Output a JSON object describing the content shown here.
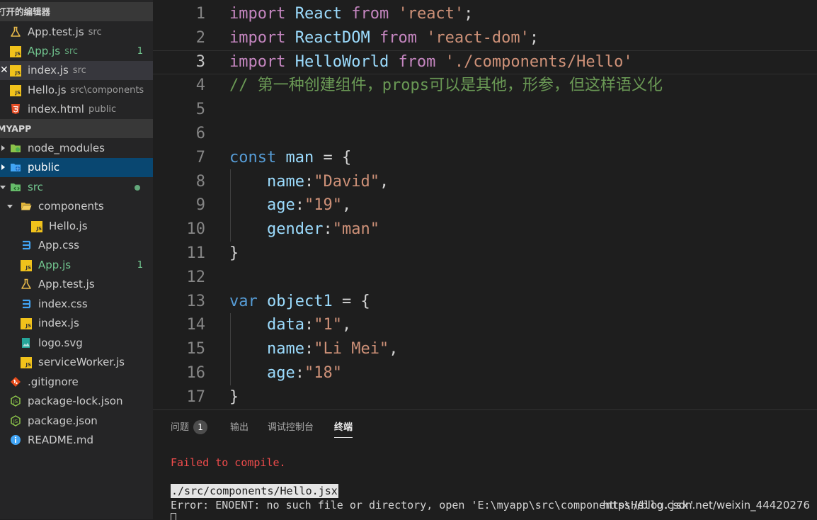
{
  "sidebar": {
    "open_editors_title": "打开的编辑器",
    "open_editors": [
      {
        "label": "App.test.js",
        "desc": "src"
      },
      {
        "label": "App.js",
        "desc": "src",
        "badge": "1"
      },
      {
        "label": "index.js",
        "desc": "src"
      },
      {
        "label": "Hello.js",
        "desc": "src\\components"
      },
      {
        "label": "index.html",
        "desc": "public"
      }
    ],
    "project_title": "MYAPP",
    "tree": [
      {
        "label": "node_modules"
      },
      {
        "label": "public"
      },
      {
        "label": "src"
      },
      {
        "label": "components"
      },
      {
        "label": "Hello.js"
      },
      {
        "label": "App.css"
      },
      {
        "label": "App.js",
        "badge": "1"
      },
      {
        "label": "App.test.js"
      },
      {
        "label": "index.css"
      },
      {
        "label": "index.js"
      },
      {
        "label": "logo.svg"
      },
      {
        "label": "serviceWorker.js"
      },
      {
        "label": ".gitignore"
      },
      {
        "label": "package-lock.json"
      },
      {
        "label": "package.json"
      },
      {
        "label": "README.md"
      }
    ]
  },
  "editor": {
    "line_numbers": [
      "1",
      "2",
      "3",
      "4",
      "5",
      "6",
      "7",
      "8",
      "9",
      "10",
      "11",
      "12",
      "13",
      "14",
      "15",
      "16",
      "17"
    ],
    "current_line": 3,
    "lines": [
      [
        [
          "kw",
          "import"
        ],
        [
          "pn",
          " "
        ],
        [
          "vr",
          "React"
        ],
        [
          "pn",
          " "
        ],
        [
          "kw",
          "from"
        ],
        [
          "pn",
          " "
        ],
        [
          "st",
          "'react'"
        ],
        [
          "pn",
          ";"
        ]
      ],
      [
        [
          "kw",
          "import"
        ],
        [
          "pn",
          " "
        ],
        [
          "vr",
          "ReactDOM"
        ],
        [
          "pn",
          " "
        ],
        [
          "kw",
          "from"
        ],
        [
          "pn",
          " "
        ],
        [
          "st",
          "'react-dom'"
        ],
        [
          "pn",
          ";"
        ]
      ],
      [
        [
          "kw",
          "import"
        ],
        [
          "pn",
          " "
        ],
        [
          "vr",
          "HelloWorld"
        ],
        [
          "pn",
          " "
        ],
        [
          "kw",
          "from"
        ],
        [
          "pn",
          " "
        ],
        [
          "st",
          "'./components/Hello'"
        ]
      ],
      [
        [
          "cm",
          "// 第一种创建组件，props可以是其他，形参，但这样语义化"
        ]
      ],
      [],
      [],
      [
        [
          "de",
          "const"
        ],
        [
          "pn",
          " "
        ],
        [
          "vr",
          "man"
        ],
        [
          "pn",
          " = {"
        ]
      ],
      [
        [
          "pn",
          "    "
        ],
        [
          "vr",
          "name"
        ],
        [
          "pn",
          ":"
        ],
        [
          "st",
          "\"David\""
        ],
        [
          "pn",
          ","
        ]
      ],
      [
        [
          "pn",
          "    "
        ],
        [
          "vr",
          "age"
        ],
        [
          "pn",
          ":"
        ],
        [
          "st",
          "\"19\""
        ],
        [
          "pn",
          ","
        ]
      ],
      [
        [
          "pn",
          "    "
        ],
        [
          "vr",
          "gender"
        ],
        [
          "pn",
          ":"
        ],
        [
          "st",
          "\"man\""
        ]
      ],
      [
        [
          "pn",
          "}"
        ]
      ],
      [],
      [
        [
          "de",
          "var"
        ],
        [
          "pn",
          " "
        ],
        [
          "vr",
          "object1"
        ],
        [
          "pn",
          " = {"
        ]
      ],
      [
        [
          "pn",
          "    "
        ],
        [
          "vr",
          "data"
        ],
        [
          "pn",
          ":"
        ],
        [
          "st",
          "\"1\""
        ],
        [
          "pn",
          ","
        ]
      ],
      [
        [
          "pn",
          "    "
        ],
        [
          "vr",
          "name"
        ],
        [
          "pn",
          ":"
        ],
        [
          "st",
          "\"Li Mei\""
        ],
        [
          "pn",
          ","
        ]
      ],
      [
        [
          "pn",
          "    "
        ],
        [
          "vr",
          "age"
        ],
        [
          "pn",
          ":"
        ],
        [
          "st",
          "\"18\""
        ]
      ],
      [
        [
          "pn",
          "}"
        ]
      ]
    ]
  },
  "panel": {
    "tabs": [
      {
        "label": "问题",
        "badge": "1"
      },
      {
        "label": "输出"
      },
      {
        "label": "调试控制台"
      },
      {
        "label": "终端",
        "active": true
      }
    ],
    "terminal": {
      "error_line": "Failed to compile.",
      "path_line": "./src/components/Hello.jsx",
      "detail_line": "Error: ENOENT: no such file or directory, open 'E:\\myapp\\src\\components\\Hello.jsx'"
    }
  },
  "watermark": "https://blog.csdn.net/weixin_44420276",
  "colors": {
    "keyword": "#c586c0",
    "string": "#ce9178",
    "variable": "#9cdcfe",
    "declaration": "#569cd6",
    "comment": "#6a9955",
    "error": "#f14c4c",
    "modified": "#73c991",
    "selection": "#094771"
  }
}
